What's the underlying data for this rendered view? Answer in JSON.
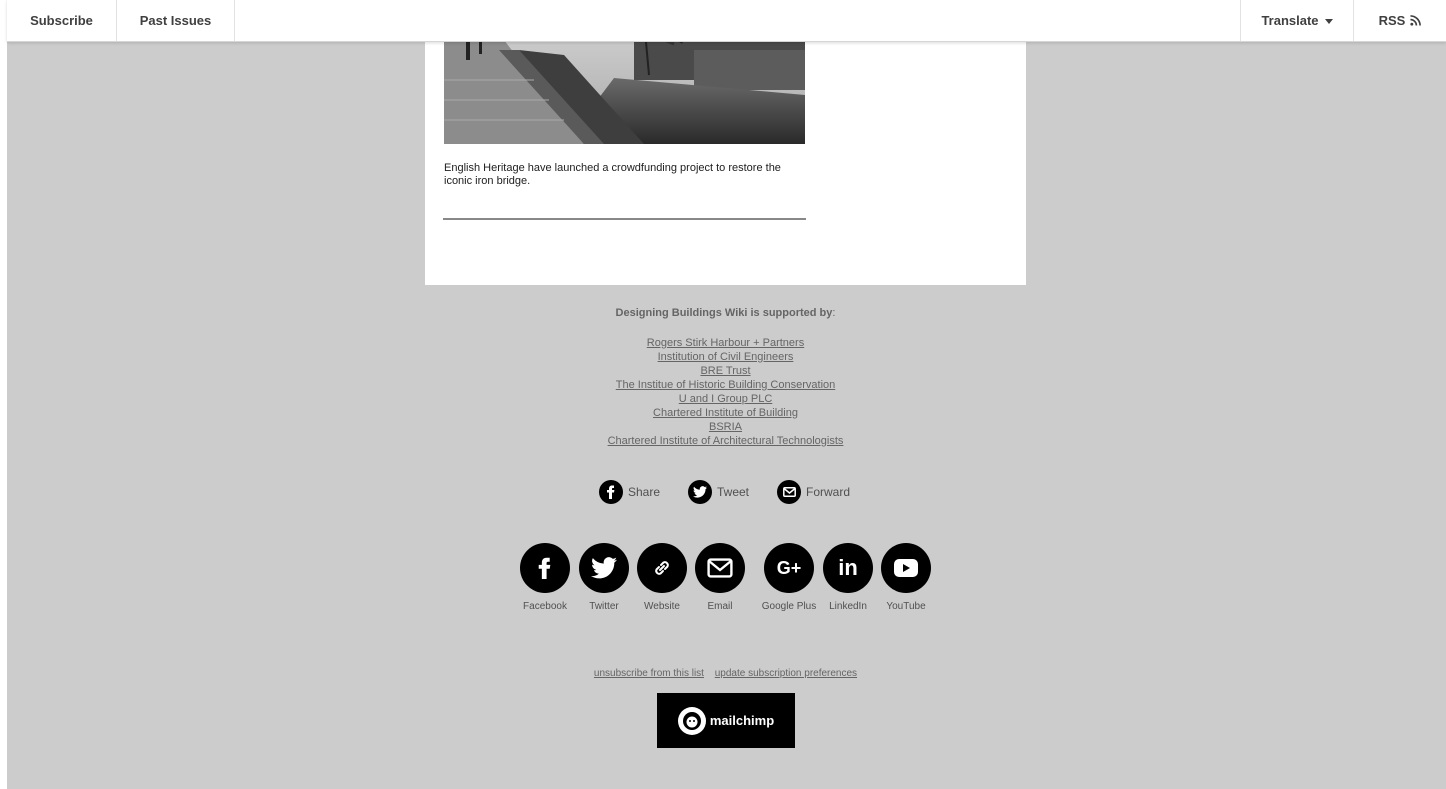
{
  "nav": {
    "subscribe_label": "Subscribe",
    "past_issues_label": "Past Issues",
    "translate_label": "Translate",
    "rss_label": "RSS"
  },
  "article": {
    "image_icon": "iron-bridge-photo",
    "caption": "English Heritage have launched a crowdfunding project to restore the iconic iron bridge."
  },
  "footer": {
    "supported_label": "Designing Buildings Wiki is supported by",
    "supported_suffix": ":",
    "sponsors": [
      "Rogers Stirk Harbour + Partners",
      "Institution of Civil Engineers",
      "BRE Trust",
      "The Institue of Historic Building Conservation",
      "U and I Group PLC",
      "Chartered Institute of Building",
      "BSRIA ",
      "Chartered Institute of Architectural Technologists"
    ],
    "share": [
      {
        "label": "Share",
        "icon": "facebook-icon"
      },
      {
        "label": "Tweet",
        "icon": "twitter-icon"
      },
      {
        "label": "Forward",
        "icon": "email-icon"
      }
    ],
    "social": [
      {
        "label": "Facebook",
        "icon": "facebook-icon"
      },
      {
        "label": "Twitter",
        "icon": "twitter-icon"
      },
      {
        "label": "Website",
        "icon": "link-icon"
      },
      {
        "label": "Email",
        "icon": "email-icon"
      },
      {
        "label": "Google Plus",
        "icon": "google-plus-icon"
      },
      {
        "label": "LinkedIn",
        "icon": "linkedin-icon"
      },
      {
        "label": "YouTube",
        "icon": "youtube-icon"
      }
    ],
    "unsubscribe_label": "unsubscribe from this list",
    "update_prefs_label": "update subscription preferences",
    "mailchimp_label": "mailchimp"
  },
  "colors": {
    "page_bg": "#cccccc",
    "card_bg": "#ffffff",
    "text_muted": "#656565",
    "icon_bg": "#000000"
  }
}
